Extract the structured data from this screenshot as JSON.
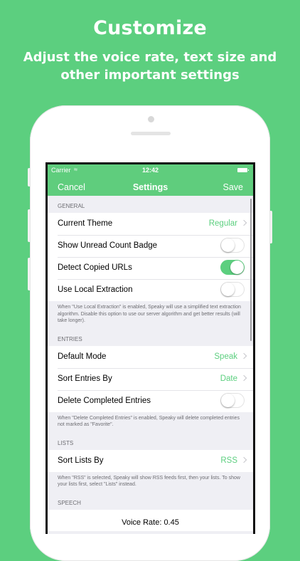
{
  "promo": {
    "title": "Customize",
    "subtitle": "Adjust the voice rate, text size and other important settings"
  },
  "status_bar": {
    "carrier": "Carrier",
    "time": "12:42",
    "wifi_icon": "wifi-icon",
    "battery_icon": "battery-icon"
  },
  "nav": {
    "cancel": "Cancel",
    "title": "Settings",
    "save": "Save"
  },
  "general": {
    "header": "GENERAL",
    "current_theme_label": "Current Theme",
    "current_theme_value": "Regular",
    "unread_badge_label": "Show Unread Count Badge",
    "unread_badge_on": false,
    "detect_urls_label": "Detect Copied URLs",
    "detect_urls_on": true,
    "local_extraction_label": "Use Local Extraction",
    "local_extraction_on": false,
    "footer": "When \"Use Local Extraction\" is enabled, Speaky will use a simplified text extraction algorithm. Disable this option to use our server algorithm and get better results (will take longer)."
  },
  "entries": {
    "header": "ENTRIES",
    "default_mode_label": "Default Mode",
    "default_mode_value": "Speak",
    "sort_by_label": "Sort Entries By",
    "sort_by_value": "Date",
    "delete_completed_label": "Delete Completed Entries",
    "delete_completed_on": false,
    "footer": "When \"Delete Completed Entries\" is enabled, Speaky will delete completed entries not marked as \"Favorite\"."
  },
  "lists": {
    "header": "LISTS",
    "sort_lists_label": "Sort Lists By",
    "sort_lists_value": "RSS",
    "footer": "When \"RSS\" is selected, Speaky will show RSS feeds first, then your lists. To show your lists first, select \"Lists\" instead."
  },
  "speech": {
    "header": "SPEECH",
    "voice_rate_label": "Voice Rate: 0.45"
  },
  "colors": {
    "accent": "#5ccf7f",
    "background": "#5ccf7f"
  }
}
